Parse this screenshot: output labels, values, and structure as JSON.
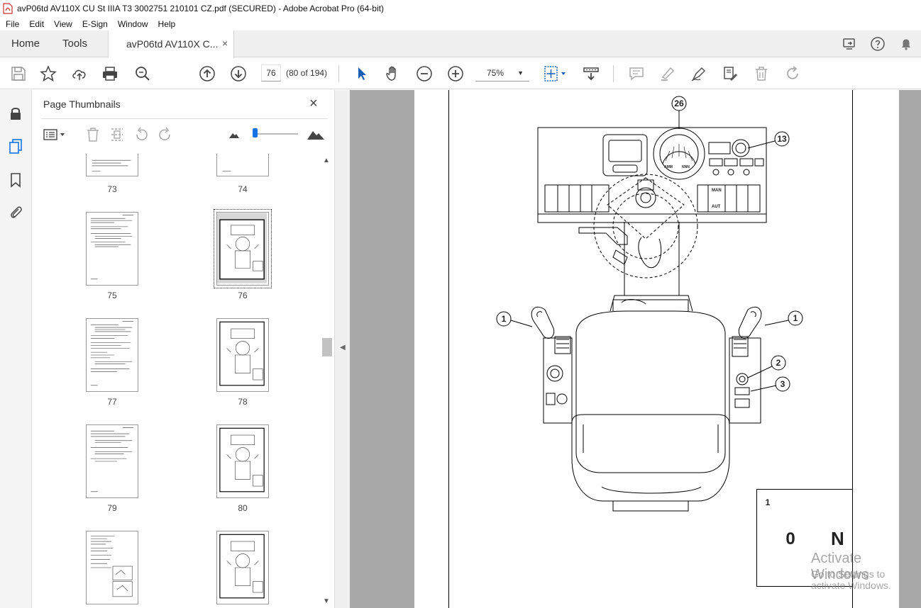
{
  "window": {
    "title": "avP06td AV110X CU St IIIA T3 3002751 210101 CZ.pdf (SECURED) - Adobe Acrobat Pro (64-bit)"
  },
  "menu": [
    "File",
    "Edit",
    "View",
    "E-Sign",
    "Window",
    "Help"
  ],
  "tabs": {
    "home": "Home",
    "tools": "Tools",
    "document": "avP06td AV110X C...",
    "close": "×"
  },
  "toolbar": {
    "page_number": "76",
    "page_count": "(80 of 194)",
    "zoom": "75%"
  },
  "thumbnails_panel": {
    "title": "Page Thumbnails",
    "close": "×",
    "pages": [
      {
        "label": "73"
      },
      {
        "label": "74"
      },
      {
        "label": "75"
      },
      {
        "label": "76",
        "selected": true
      },
      {
        "label": "77"
      },
      {
        "label": "78"
      },
      {
        "label": "79"
      },
      {
        "label": "80"
      },
      {
        "label": ""
      },
      {
        "label": ""
      }
    ]
  },
  "document": {
    "callouts": {
      "c26": "26",
      "c13": "13",
      "c1_left": "1",
      "c1_right": "1",
      "c2": "2",
      "c3": "3"
    },
    "legend": {
      "number": "1",
      "zero": "0",
      "n": "N"
    },
    "dash_labels": {
      "man": "MAN",
      "aut": "AUT",
      "gauge_left": "AMM",
      "gauge_right": "NNN"
    }
  },
  "watermark": {
    "line1": "Activate Windows",
    "line2": "Go to Settings to activate Windows."
  }
}
